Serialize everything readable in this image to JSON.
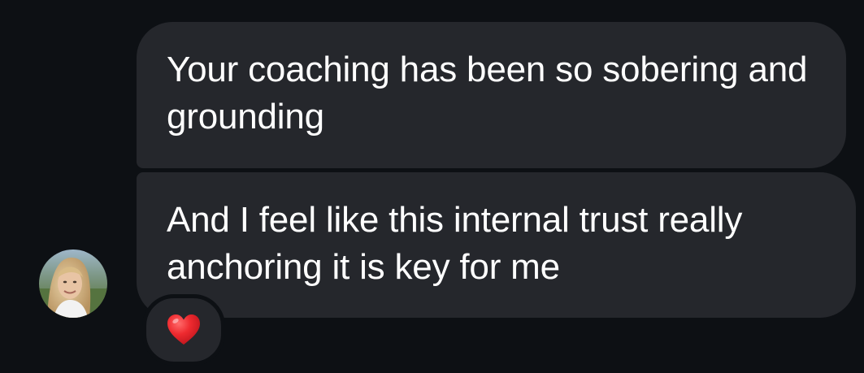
{
  "messages": [
    {
      "text": "Your coaching has been so sobering and grounding"
    },
    {
      "text": "And I feel like this internal trust really anchoring it is key for me"
    }
  ],
  "reaction": {
    "icon": "heart-icon",
    "color": "#e0202a"
  },
  "colors": {
    "background": "#0d1014",
    "bubble": "#25272c",
    "text": "#ffffff"
  }
}
